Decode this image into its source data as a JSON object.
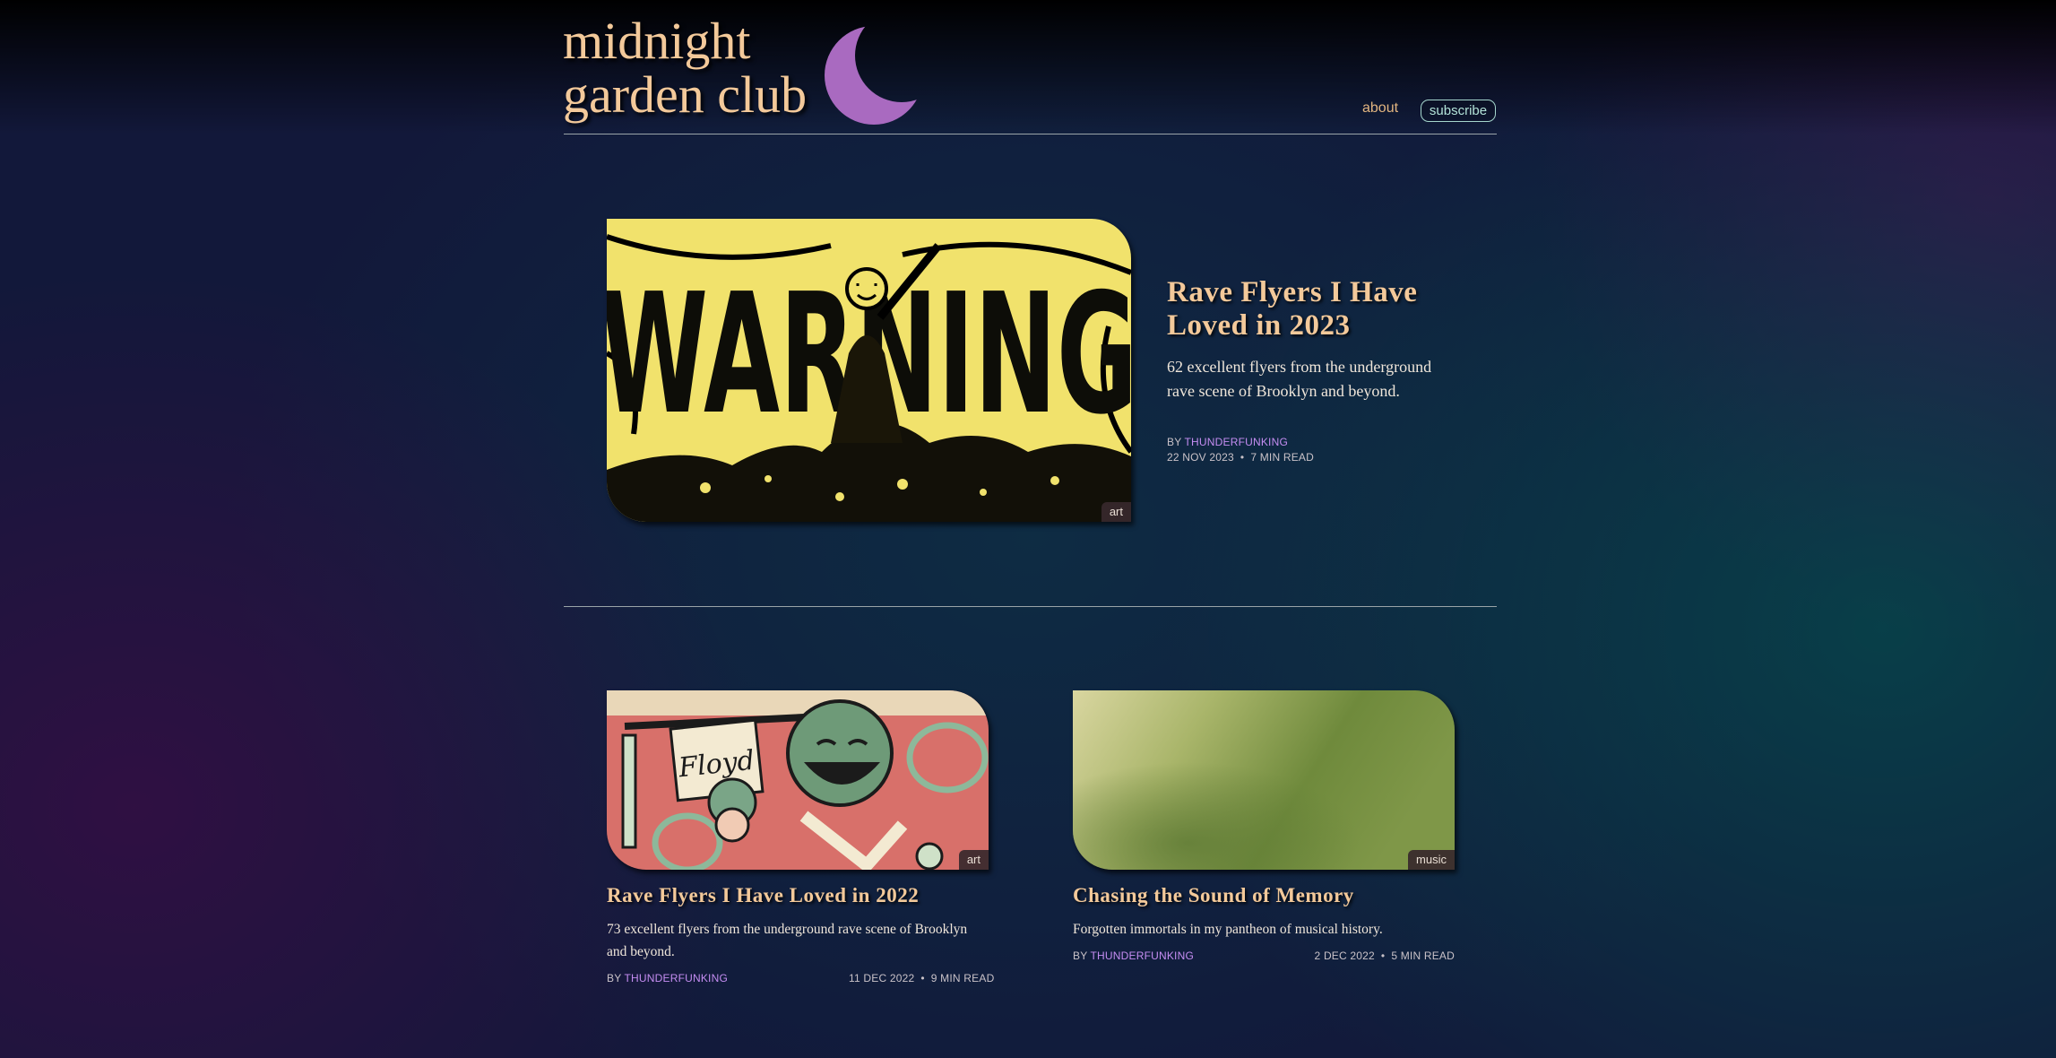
{
  "site": {
    "title_line1": "midnight",
    "title_line2": "garden club",
    "moon_icon": "crescent-moon-icon"
  },
  "nav": {
    "about": "about",
    "subscribe": "subscribe"
  },
  "featured": {
    "title": "Rave Flyers I Have Loved in 2023",
    "excerpt": "62 excellent flyers from the underground rave scene of Brooklyn and beyond.",
    "by": "BY",
    "author": "THUNDERFUNKING",
    "date": "22 NOV 2023",
    "separator": "•",
    "read_time": "7 MIN READ",
    "tag": "art",
    "image_text": "WARNING"
  },
  "posts": [
    {
      "title": "Rave Flyers I Have Loved in 2022",
      "excerpt": "73 excellent flyers from the underground rave scene of Brooklyn and beyond.",
      "by": "BY",
      "author": "THUNDERFUNKING",
      "date": "11 DEC 2022",
      "separator": "•",
      "read_time": "9 MIN READ",
      "tag": "art",
      "image_text": "Floyd"
    },
    {
      "title": "Chasing the Sound of Memory",
      "excerpt": "Forgotten immortals in my pantheon of musical history.",
      "by": "BY",
      "author": "THUNDERFUNKING",
      "date": "2 DEC 2022",
      "separator": "•",
      "read_time": "5 MIN READ",
      "tag": "music"
    }
  ],
  "colors": {
    "title": "#f3c99a",
    "author": "#c58df2",
    "moon": "#a96ac0",
    "subscribe_border": "#a5d6cd"
  }
}
